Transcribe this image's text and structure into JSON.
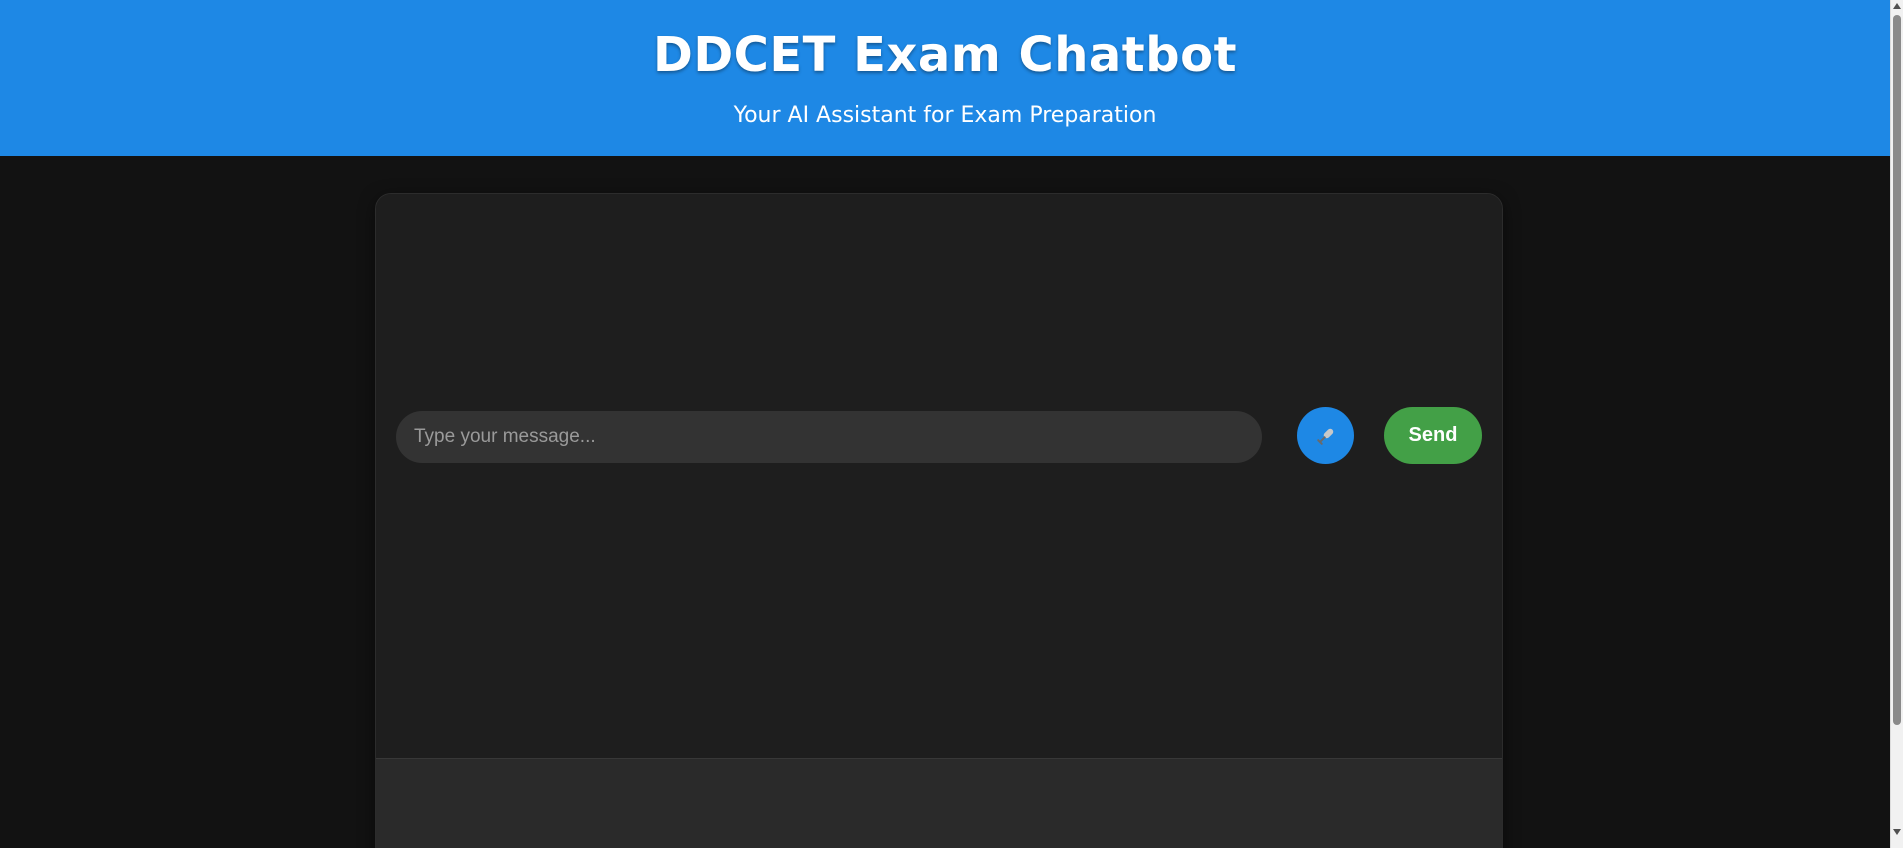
{
  "header": {
    "title": "DDCET Exam Chatbot",
    "subtitle": "Your AI Assistant for Exam Preparation"
  },
  "chat": {
    "messages": [],
    "input": {
      "value": "",
      "placeholder": "Type your message..."
    },
    "mic_icon": "microphone-icon",
    "send_label": "Send"
  },
  "colors": {
    "header_background": "#1e88e5",
    "page_background": "#121212",
    "chat_background": "#1e1e1e",
    "input_bar_background": "#2a2a2a",
    "mic_button": "#1e88e5",
    "send_button": "#43a047"
  }
}
